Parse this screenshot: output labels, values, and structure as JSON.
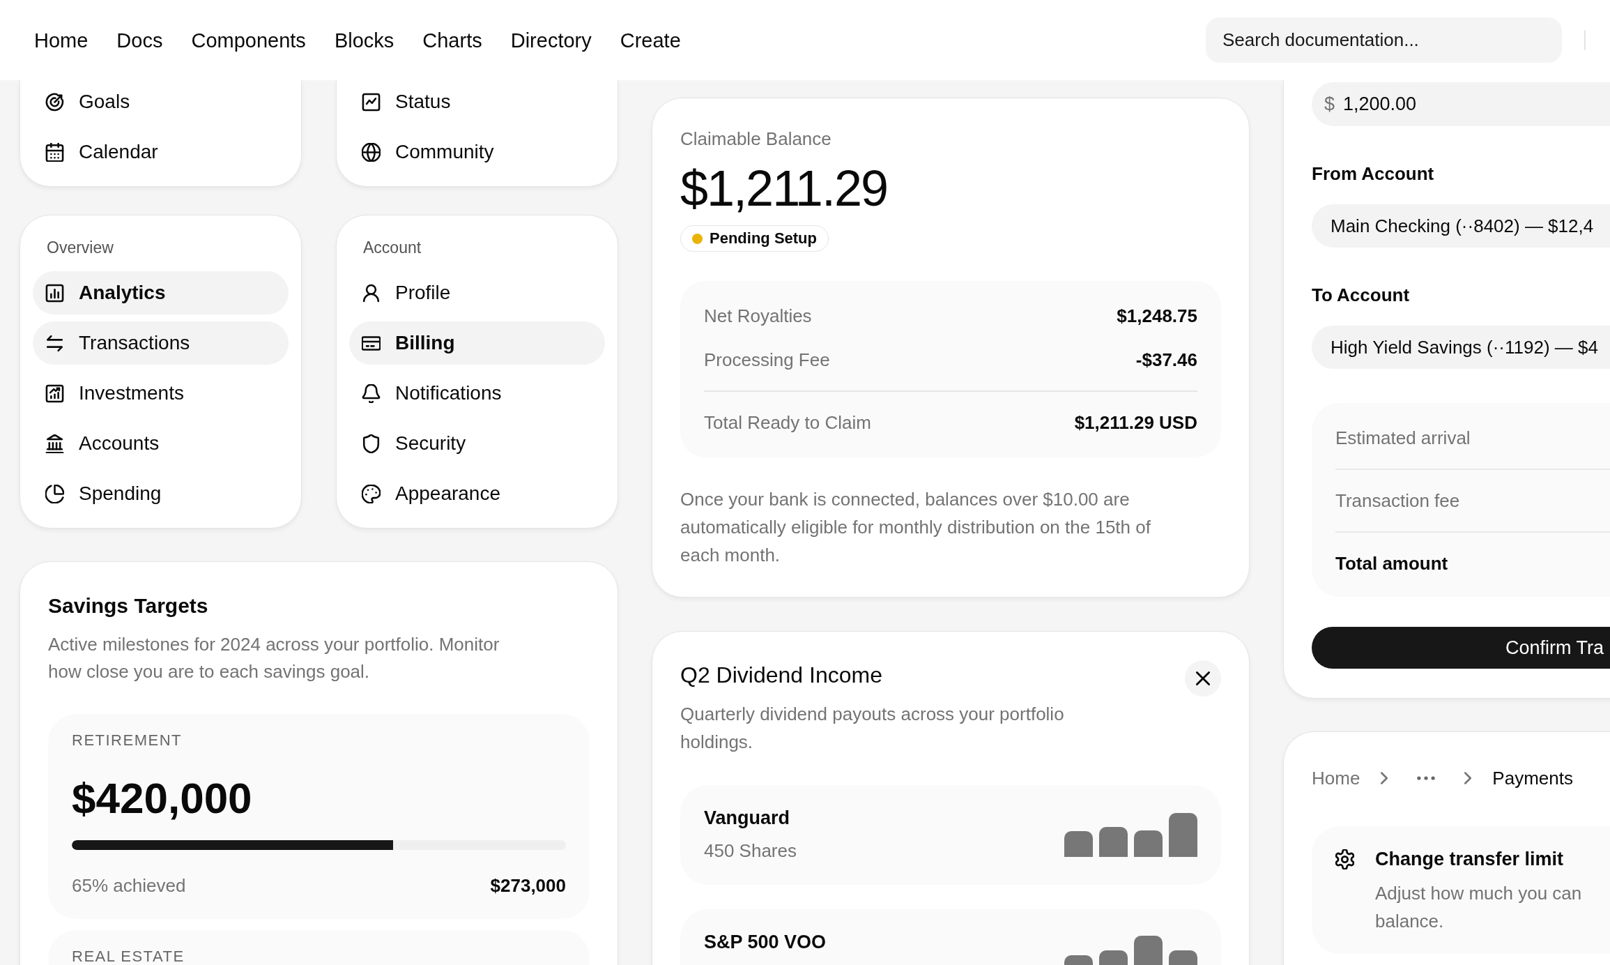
{
  "nav": {
    "links": [
      {
        "label": "Home"
      },
      {
        "label": "Docs"
      },
      {
        "label": "Components"
      },
      {
        "label": "Blocks"
      },
      {
        "label": "Charts"
      },
      {
        "label": "Directory"
      },
      {
        "label": "Create"
      }
    ],
    "search": {
      "label": "Search documentation..."
    }
  },
  "menu_cards": [
    {
      "items": [
        {
          "label": "Goals",
          "selected": false,
          "hovered": false
        },
        {
          "label": "Calendar",
          "selected": false,
          "hovered": false
        }
      ]
    },
    {
      "items": [
        {
          "label": "Status",
          "selected": false,
          "hovered": false
        },
        {
          "label": "Community",
          "selected": false,
          "hovered": false
        }
      ]
    },
    {
      "heading": "Overview",
      "items": [
        {
          "label": "Analytics",
          "selected": true,
          "hovered": false
        },
        {
          "label": "Transactions",
          "selected": false,
          "hovered": true
        },
        {
          "label": "Investments",
          "selected": false,
          "hovered": false
        },
        {
          "label": "Accounts",
          "selected": false,
          "hovered": false
        },
        {
          "label": "Spending",
          "selected": false,
          "hovered": false
        }
      ]
    },
    {
      "heading": "Account",
      "items": [
        {
          "label": "Profile",
          "selected": false,
          "hovered": false
        },
        {
          "label": "Billing",
          "selected": true,
          "hovered": false
        },
        {
          "label": "Notifications",
          "selected": false,
          "hovered": false
        },
        {
          "label": "Security",
          "selected": false,
          "hovered": false
        },
        {
          "label": "Appearance",
          "selected": false,
          "hovered": false
        }
      ]
    }
  ],
  "savings_targets": {
    "title": "Savings Targets",
    "description": "Active milestones for 2024 across your portfolio. Monitor how close you are to each savings goal.",
    "goals": [
      {
        "category": "RETIREMENT",
        "amount": "$420,000",
        "level": 0.65,
        "progress_label": "65% achieved",
        "saved": "$273,000"
      },
      {
        "category": "REAL ESTATE"
      }
    ]
  },
  "claimable_balance": {
    "label": "Claimable Balance",
    "amount": "$1,211.29",
    "status": {
      "label": "Pending Setup",
      "color": "#eab308"
    },
    "breakdown": [
      {
        "kind": "line",
        "label": "Net Royalties",
        "value": "$1,248.75"
      },
      {
        "kind": "line",
        "label": "Processing Fee",
        "value": "-$37.46"
      },
      {
        "kind": "total",
        "label": "Total Ready to Claim",
        "value": "$1,211.29 USD"
      }
    ],
    "note": "Once your bank is connected, balances over $10.00 are automatically eligible for monthly distribution on the 15th of each month."
  },
  "dividend_income": {
    "title": "Q2 Dividend Income",
    "description": "Quarterly dividend payouts across your portfolio holdings.",
    "holdings": [
      {
        "name": "Vanguard",
        "shares": "450 Shares"
      },
      {
        "name": "S&P 500 VOO"
      }
    ]
  },
  "transfer": {
    "amount_field": {
      "currency": "$",
      "value": "1,200.00"
    },
    "accounts": [
      {
        "label": "From Account",
        "value": "Main Checking (··8402) — $12,4"
      },
      {
        "label": "To Account",
        "value": "High Yield Savings (··1192) — $4"
      }
    ],
    "summary": [
      {
        "kind": "line",
        "label": "Estimated arrival"
      },
      {
        "kind": "line",
        "label": "Transaction fee"
      },
      {
        "kind": "total",
        "label": "Total amount"
      }
    ],
    "confirm_button": {
      "label": "Confirm Tra"
    }
  },
  "payments": {
    "breadcrumb": [
      {
        "kind": "link",
        "label": "Home"
      },
      {
        "kind": "ellipsis"
      },
      {
        "kind": "current",
        "label": "Payments"
      }
    ],
    "settings_item": {
      "title": "Change transfer limit",
      "description_lines": [
        "Adjust how much you can",
        "balance."
      ]
    }
  }
}
